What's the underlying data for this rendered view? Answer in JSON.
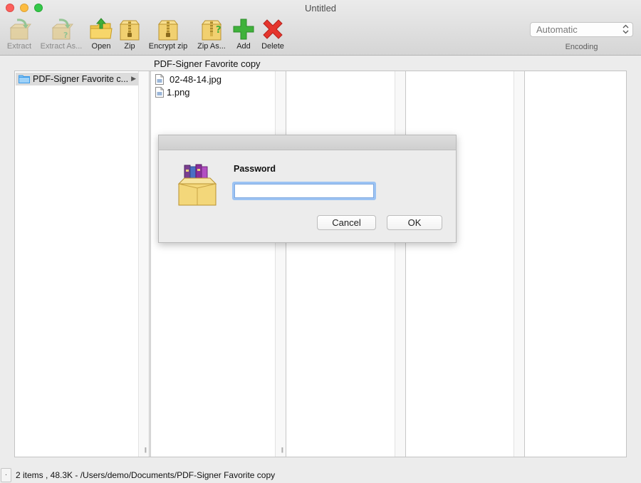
{
  "window": {
    "title": "Untitled"
  },
  "toolbar": {
    "items": [
      {
        "label": "Extract",
        "icon": "box-arrow-icon",
        "enabled": false
      },
      {
        "label": "Extract As...",
        "icon": "box-arrow-question-icon",
        "enabled": false
      },
      {
        "label": "Open",
        "icon": "folder-open-icon",
        "enabled": true
      },
      {
        "label": "Zip",
        "icon": "zip-box-icon",
        "enabled": true
      },
      {
        "label": "Encrypt zip",
        "icon": "zip-box-lock-icon",
        "enabled": true
      },
      {
        "label": "Zip As...",
        "icon": "zip-box-question-icon",
        "enabled": true
      },
      {
        "label": "Add",
        "icon": "plus-icon",
        "enabled": true
      },
      {
        "label": "Delete",
        "icon": "x-icon",
        "enabled": true
      }
    ],
    "encoding": {
      "value": "Automatic",
      "label": "Encoding"
    }
  },
  "browser": {
    "path_title": "PDF-Signer Favorite copy",
    "column1": {
      "selected_folder": "PDF-Signer Favorite c..."
    },
    "column2": {
      "files": [
        "02-48-14.jpg",
        "1.png"
      ]
    }
  },
  "dialog": {
    "label": "Password",
    "password_value": "",
    "cancel_label": "Cancel",
    "ok_label": "OK"
  },
  "status": {
    "button_label": ".",
    "text": "2 items , 48.3K - /Users/demo/Documents/PDF-Signer Favorite copy"
  },
  "colors": {
    "accent_focus": "#9cc3f3",
    "folder_blue": "#3d9be9",
    "add_green": "#3fb23b",
    "delete_red": "#e5352d"
  }
}
